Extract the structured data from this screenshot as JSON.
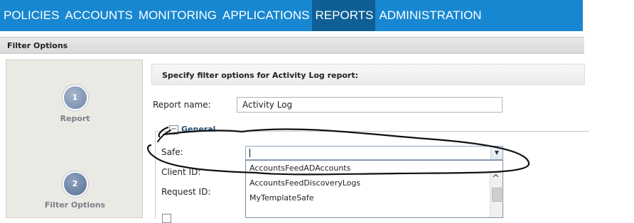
{
  "nav": {
    "items": [
      {
        "label": "POLICIES",
        "active": false
      },
      {
        "label": "ACCOUNTS",
        "active": false
      },
      {
        "label": "MONITORING",
        "active": false
      },
      {
        "label": "APPLICATIONS",
        "active": false
      },
      {
        "label": "REPORTS",
        "active": true
      },
      {
        "label": "ADMINISTRATION",
        "active": false
      }
    ],
    "bar_color": "#1787d1",
    "active_color": "#0f5f96"
  },
  "header": {
    "title": "Filter Options"
  },
  "wizard": {
    "steps": [
      {
        "number": "1",
        "label": "Report"
      },
      {
        "number": "2",
        "label": "Filter Options"
      }
    ]
  },
  "form": {
    "section_title": "Specify filter options for Activity Log report:",
    "report_name_label": "Report name:",
    "report_name_value": "Activity Log",
    "group_title": "General",
    "safe_label": "Safe:",
    "safe_value": "",
    "client_id_label": "Client ID:",
    "request_id_label": "Request ID:",
    "safe_options": [
      "AccountsFeedADAccounts",
      "AccountsFeedDiscoveryLogs",
      "MyTemplateSafe"
    ]
  }
}
